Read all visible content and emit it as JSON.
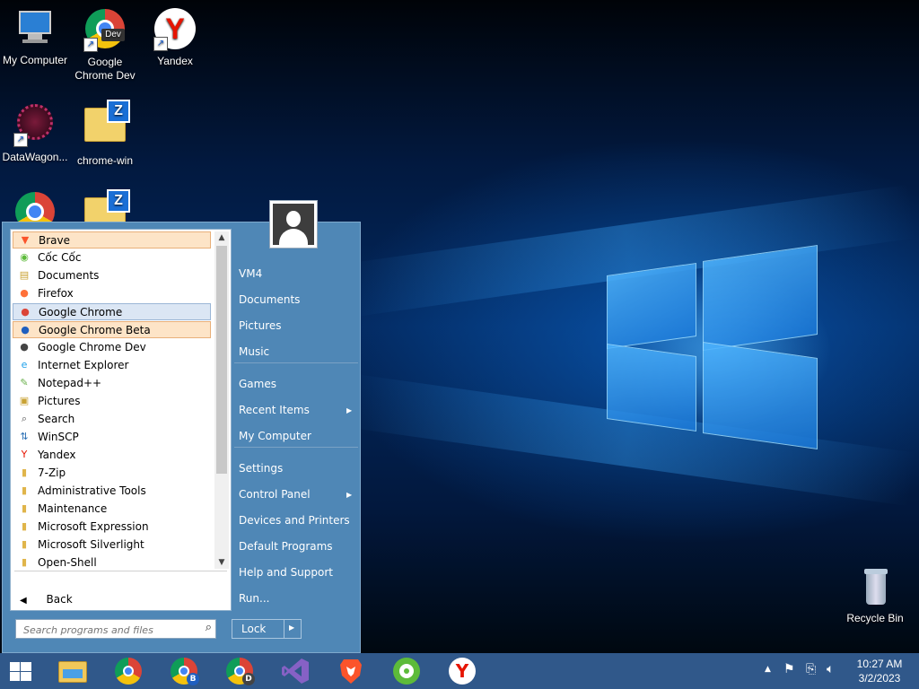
{
  "desktop": {
    "icons": [
      {
        "label": "My Computer",
        "icon": "my-computer-icon"
      },
      {
        "label": "Google\nChrome Dev",
        "icon": "chrome-dev-icon",
        "badge": "Dev"
      },
      {
        "label": "Yandex",
        "icon": "yandex-icon"
      },
      {
        "label": "DataWagon...",
        "icon": "datawagon-icon"
      },
      {
        "label": "chrome-win",
        "icon": "folder-zip-icon"
      },
      {
        "label": "Recycle Bin",
        "icon": "recycle-bin-icon"
      }
    ]
  },
  "start_menu": {
    "programs": [
      {
        "label": "Brave",
        "icon": "brave-icon",
        "state": "highlighted"
      },
      {
        "label": "Cốc Cốc",
        "icon": "coccoc-icon"
      },
      {
        "label": "Documents",
        "icon": "documents-icon"
      },
      {
        "label": "Firefox",
        "icon": "firefox-icon"
      },
      {
        "label": "Google Chrome",
        "icon": "chrome-icon",
        "state": "selected"
      },
      {
        "label": "Google Chrome Beta",
        "icon": "chrome-beta-icon",
        "state": "highlighted"
      },
      {
        "label": "Google Chrome Dev",
        "icon": "chrome-dev-icon"
      },
      {
        "label": "Internet Explorer",
        "icon": "internet-explorer-icon"
      },
      {
        "label": "Notepad++",
        "icon": "notepadpp-icon"
      },
      {
        "label": "Pictures",
        "icon": "pictures-icon"
      },
      {
        "label": "Search",
        "icon": "search-icon"
      },
      {
        "label": "WinSCP",
        "icon": "winscp-icon"
      },
      {
        "label": "Yandex",
        "icon": "yandex-icon"
      },
      {
        "label": "7-Zip",
        "icon": "folder-icon"
      },
      {
        "label": "Administrative Tools",
        "icon": "folder-icon"
      },
      {
        "label": "Maintenance",
        "icon": "folder-icon"
      },
      {
        "label": "Microsoft Expression",
        "icon": "folder-icon"
      },
      {
        "label": "Microsoft Silverlight",
        "icon": "folder-icon"
      },
      {
        "label": "Open-Shell",
        "icon": "folder-icon"
      }
    ],
    "back_label": "Back",
    "search_placeholder": "Search programs and files",
    "right_links": [
      {
        "label": "VM4"
      },
      {
        "label": "Documents"
      },
      {
        "label": "Pictures"
      },
      {
        "label": "Music"
      },
      {
        "label": "Games"
      },
      {
        "label": "Recent Items",
        "submenu": true
      },
      {
        "label": "My Computer"
      },
      {
        "label": "Settings"
      },
      {
        "label": "Control Panel",
        "submenu": true
      },
      {
        "label": "Devices and Printers"
      },
      {
        "label": "Default Programs"
      },
      {
        "label": "Help and Support"
      },
      {
        "label": "Run..."
      }
    ],
    "lock_label": "Lock"
  },
  "taskbar": {
    "pinned": [
      "start-icon",
      "file-explorer-icon",
      "chrome-icon",
      "chrome-beta-icon",
      "chrome-dev-icon",
      "visual-studio-icon",
      "brave-icon",
      "coccoc-icon",
      "yandex-icon"
    ],
    "clock_time": "10:27 AM",
    "clock_date": "3/2/2023"
  },
  "colors": {
    "start_menu_bg": "#4f87b6",
    "taskbar_bg": "#30588a",
    "highlight_bg": "#fde4c7",
    "selected_bg": "#dbe6f4"
  }
}
